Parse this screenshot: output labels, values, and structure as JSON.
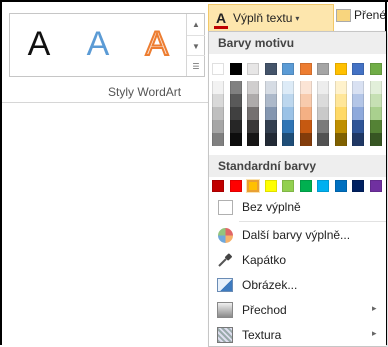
{
  "wordart": {
    "sample_glyph": "A",
    "group_label": "Styly WordArt"
  },
  "fill_button": {
    "icon_glyph": "A",
    "label": "Výplň textu",
    "dropdown_glyph": "▾",
    "underline_color": "#c00000"
  },
  "outline_button": {
    "label": "Přené"
  },
  "menu": {
    "theme_header": "Barvy motivu",
    "standard_header": "Standardní barvy",
    "theme_colors": [
      "#ffffff",
      "#000000",
      "#e7e6e6",
      "#44546a",
      "#5b9bd5",
      "#ed7d31",
      "#a5a5a5",
      "#ffc000",
      "#4472c4",
      "#70ad47"
    ],
    "theme_shades": [
      [
        "#f2f2f2",
        "#d9d9d9",
        "#bfbfbf",
        "#a6a6a6",
        "#808080"
      ],
      [
        "#808080",
        "#595959",
        "#404040",
        "#262626",
        "#0d0d0d"
      ],
      [
        "#d0cece",
        "#aeabab",
        "#757171",
        "#3a3838",
        "#171616"
      ],
      [
        "#d6dce4",
        "#adb9ca",
        "#8496b0",
        "#333f4f",
        "#222a35"
      ],
      [
        "#ddebf7",
        "#bdd7ee",
        "#9bc2e6",
        "#2f75b5",
        "#1f4e78"
      ],
      [
        "#fbe4d5",
        "#f8cbad",
        "#f4b084",
        "#c65911",
        "#833c0b"
      ],
      [
        "#ededed",
        "#dbdbdb",
        "#c9c9c9",
        "#7b7b7b",
        "#525252"
      ],
      [
        "#fff2cc",
        "#ffe699",
        "#ffd966",
        "#bf8f00",
        "#7f6000"
      ],
      [
        "#d9e1f2",
        "#b4c6e7",
        "#8ea9db",
        "#2f5597",
        "#203864"
      ],
      [
        "#e2efda",
        "#c6e0b4",
        "#a9d08e",
        "#548235",
        "#375623"
      ]
    ],
    "standard_colors": [
      "#c00000",
      "#ff0000",
      "#ffc000",
      "#ffff00",
      "#92d050",
      "#00b050",
      "#00b0f0",
      "#0070c0",
      "#002060",
      "#7030a0"
    ],
    "selected_standard_color": "#ffc000",
    "items": [
      {
        "label": "Bez výplně",
        "icon": "no-fill-icon"
      },
      {
        "label": "Další barvy výplně...",
        "icon": "color-wheel-icon"
      },
      {
        "label": "Kapátko",
        "icon": "eyedropper-icon"
      },
      {
        "label": "Obrázek...",
        "icon": "picture-icon"
      },
      {
        "label": "Přechod",
        "icon": "gradient-icon",
        "submenu_glyph": "▸"
      },
      {
        "label": "Textura",
        "icon": "texture-icon",
        "submenu_glyph": "▸"
      }
    ]
  }
}
